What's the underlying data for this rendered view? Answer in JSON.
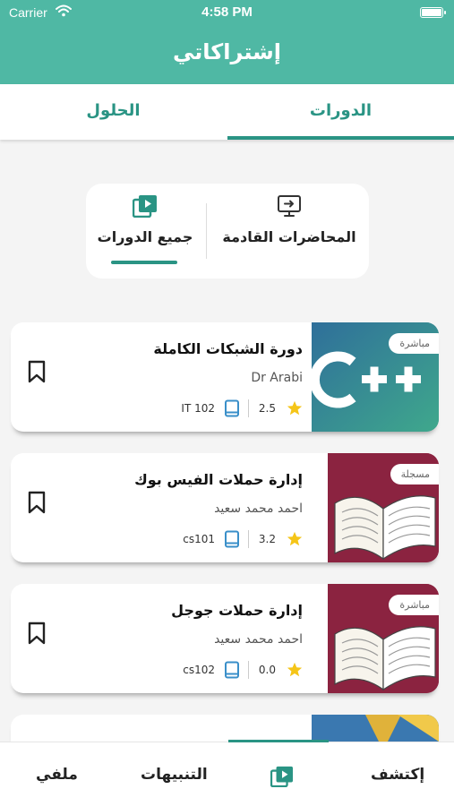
{
  "status_bar": {
    "carrier": "Carrier",
    "time": "4:58 PM"
  },
  "header": {
    "title": "إشتراكاتي"
  },
  "tabs": [
    {
      "label": "الدورات",
      "active": true
    },
    {
      "label": "الحلول",
      "active": false
    }
  ],
  "segment": {
    "all_courses": {
      "label": "جميع الدورات",
      "active": true,
      "icon": "play-library-icon"
    },
    "upcoming_lectures": {
      "label": "المحاضرات القادمة",
      "active": false,
      "icon": "screen-share-icon"
    }
  },
  "courses": [
    {
      "title": "دورة الشبكات الكاملة",
      "author": "Dr Arabi",
      "rating": "2.5",
      "code": "IT 102",
      "badge": "مباشرة",
      "thumbnail": "cpp-logo"
    },
    {
      "title": "إدارة حملات الفيس بوك",
      "author": "احمد محمد سعيد",
      "rating": "3.2",
      "code": "cs101",
      "badge": "مسجلة",
      "thumbnail": "open-book"
    },
    {
      "title": "إدارة حملات جوجل",
      "author": "احمد محمد سعيد",
      "rating": "0.0",
      "code": "cs102",
      "badge": "مباشرة",
      "thumbnail": "open-book"
    }
  ],
  "tab_bar": {
    "discover": "إكتشف",
    "subscriptions_icon": "play-library-icon",
    "notifications": "التنبيهات",
    "profile": "ملفي"
  },
  "colors": {
    "primary": "#4fb8a4",
    "accent": "#2a9484",
    "star": "#f5c518",
    "book_icon": "#3a8fc9",
    "thumb_maroon": "#8b2340"
  }
}
